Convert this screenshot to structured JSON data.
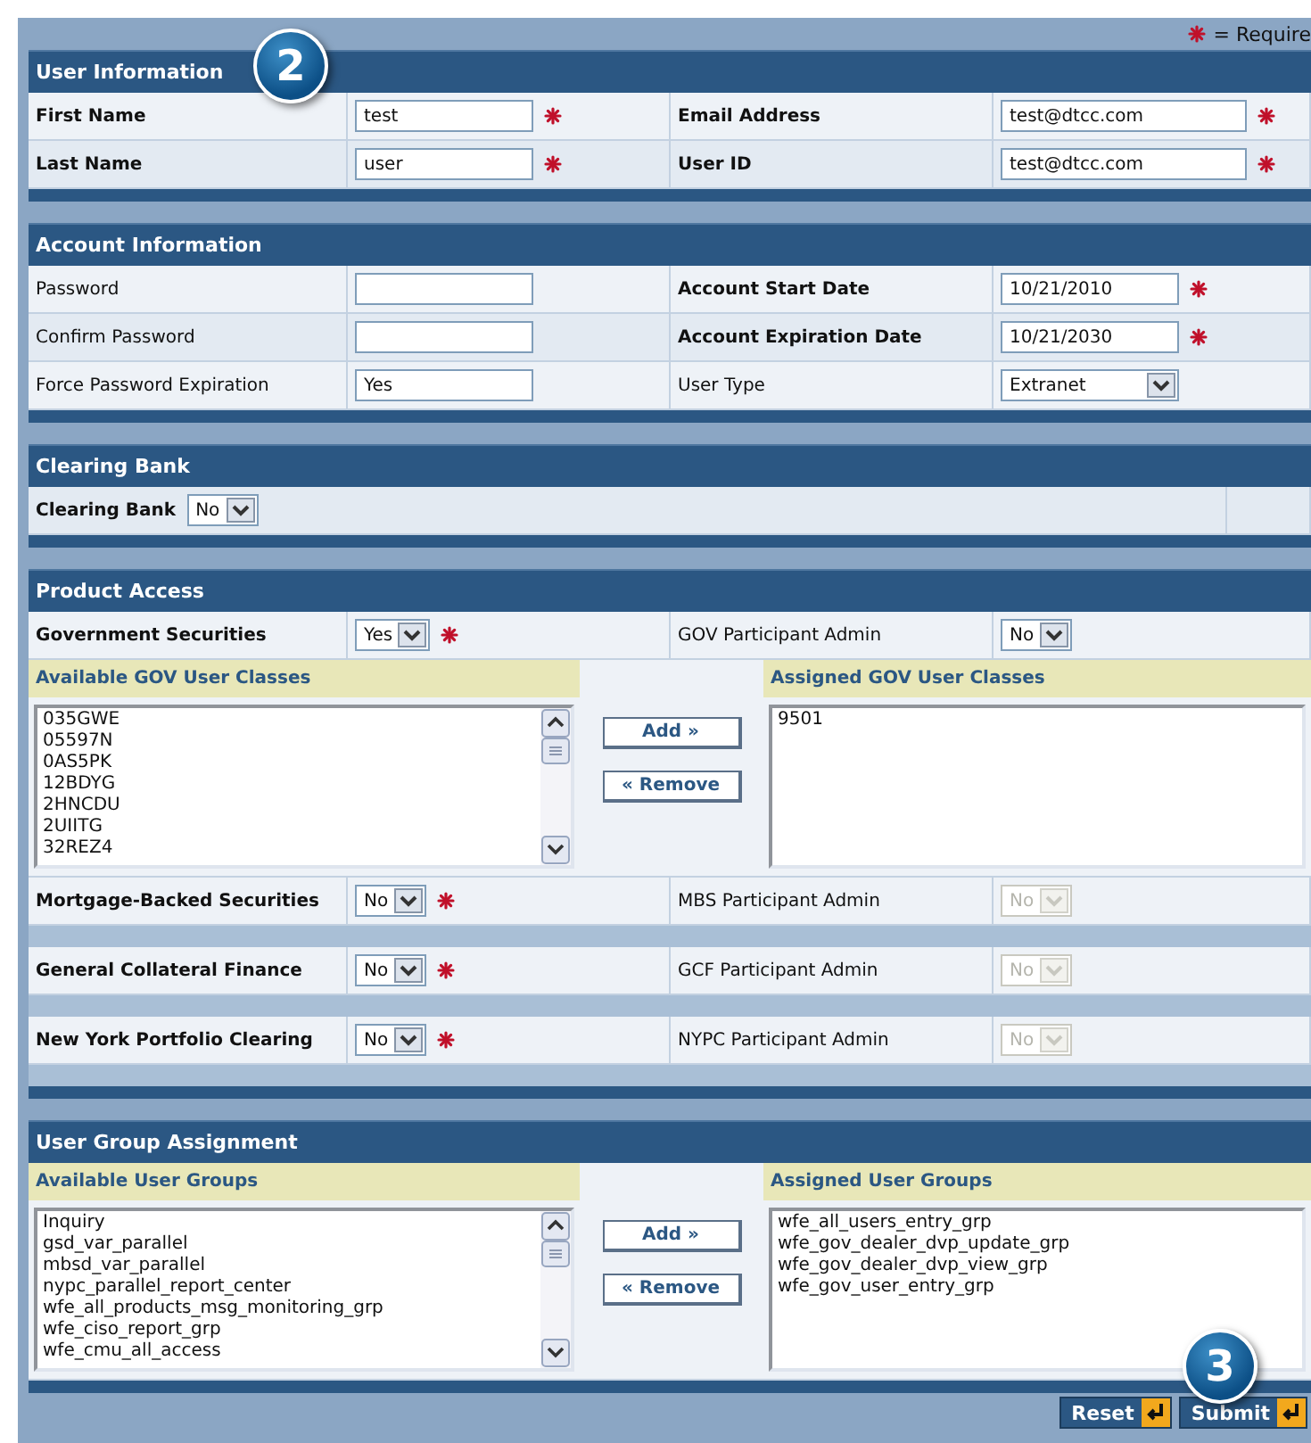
{
  "legend": {
    "text": "= Require"
  },
  "sections": [
    {
      "kind": "form",
      "title": "User Information",
      "callout": "2",
      "rows": [
        {
          "left": {
            "label": "First Name",
            "bold": true,
            "control": {
              "kind": "input",
              "value": "test",
              "required": true
            }
          },
          "right": {
            "label": "Email Address",
            "bold": true,
            "control": {
              "kind": "input",
              "value": "test@dtcc.com",
              "required": true
            }
          }
        },
        {
          "left": {
            "label": "Last Name",
            "bold": true,
            "control": {
              "kind": "input",
              "value": "user",
              "required": true
            }
          },
          "right": {
            "label": "User ID",
            "bold": true,
            "control": {
              "kind": "input",
              "value": "test@dtcc.com",
              "required": true
            }
          }
        }
      ]
    },
    {
      "kind": "form",
      "title": "Account Information",
      "rows": [
        {
          "left": {
            "label": "Password",
            "bold": false,
            "control": {
              "kind": "input",
              "required": false
            }
          },
          "right": {
            "label": "Account Start Date",
            "bold": true,
            "control": {
              "kind": "input",
              "value": "10/21/2010",
              "required": true
            }
          }
        },
        {
          "left": {
            "label": "Confirm Password",
            "bold": false,
            "control": {
              "kind": "input",
              "required": false
            }
          },
          "right": {
            "label": "Account Expiration Date",
            "bold": true,
            "control": {
              "kind": "input",
              "value": "10/21/2030",
              "required": true
            }
          }
        },
        {
          "left": {
            "label": "Force Password Expiration",
            "bold": false,
            "control": {
              "kind": "input",
              "value": "Yes",
              "required": false
            }
          },
          "right": {
            "label": "User Type",
            "bold": false,
            "control": {
              "kind": "select",
              "value": "Extranet",
              "required": false,
              "disabled": false
            }
          }
        }
      ]
    },
    {
      "kind": "inline",
      "title": "Clearing Bank",
      "label": "Clearing Bank",
      "control": {
        "kind": "select",
        "value": "No",
        "required": false,
        "disabled": false
      }
    },
    {
      "kind": "products",
      "title": "Product Access",
      "products": [
        {
          "label": "Government Securities",
          "control": {
            "kind": "select",
            "value": "Yes",
            "required": true,
            "disabled": false
          },
          "admin": {
            "label": "GOV Participant Admin",
            "control": {
              "kind": "select",
              "value": "No",
              "required": false,
              "disabled": false
            }
          },
          "transfer": {
            "available": {
              "title": "Available GOV User Classes",
              "items": [
                "035GWE",
                "05597N",
                "0AS5PK",
                "12BDYG",
                "2HNCDU",
                "2UIITG",
                "32REZ4"
              ]
            },
            "assigned": {
              "title": "Assigned GOV User Classes",
              "items": [
                "9501"
              ]
            },
            "buttons": [
              "Add »",
              "« Remove"
            ]
          }
        },
        {
          "label": "Mortgage-Backed Securities",
          "control": {
            "kind": "select",
            "value": "No",
            "required": true,
            "disabled": false
          },
          "admin": {
            "label": "MBS Participant Admin",
            "control": {
              "kind": "select",
              "value": "No",
              "required": false,
              "disabled": true
            }
          }
        },
        {
          "label": "General Collateral Finance",
          "control": {
            "kind": "select",
            "value": "No",
            "required": true,
            "disabled": false
          },
          "admin": {
            "label": "GCF Participant Admin",
            "control": {
              "kind": "select",
              "value": "No",
              "required": false,
              "disabled": true
            }
          }
        },
        {
          "label": "New York Portfolio Clearing",
          "control": {
            "kind": "select",
            "value": "No",
            "required": true,
            "disabled": false
          },
          "admin": {
            "label": "NYPC Participant Admin",
            "control": {
              "kind": "select",
              "value": "No",
              "required": false,
              "disabled": true
            }
          }
        }
      ]
    },
    {
      "kind": "transfer",
      "title": "User Group Assignment",
      "transfer": {
        "available": {
          "title": "Available User Groups",
          "items": [
            "Inquiry",
            "gsd_var_parallel",
            "mbsd_var_parallel",
            "nypc_parallel_report_center",
            "wfe_all_products_msg_monitoring_grp",
            "wfe_ciso_report_grp",
            "wfe_cmu_all_access"
          ]
        },
        "assigned": {
          "title": "Assigned User Groups",
          "items": [
            "wfe_all_users_entry_grp",
            "wfe_gov_dealer_dvp_update_grp",
            "wfe_gov_dealer_dvp_view_grp",
            "wfe_gov_user_entry_grp"
          ]
        },
        "buttons": [
          "Add »",
          "« Remove"
        ]
      }
    }
  ],
  "footer": {
    "callout": "3",
    "buttons": [
      "Reset",
      "Submit"
    ]
  }
}
